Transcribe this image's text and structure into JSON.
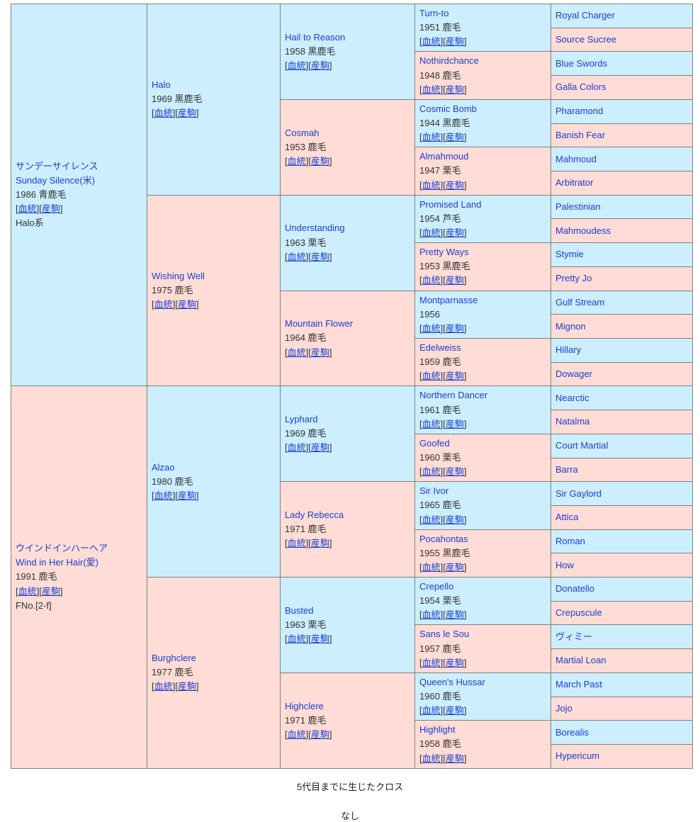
{
  "colors": {
    "sire_bg": "#cceeff",
    "dam_bg": "#ffdcd6",
    "border": "#808080",
    "link": "#1a3fd0",
    "text": "#333333"
  },
  "labels": {
    "pedigree_link": "血統",
    "offspring_link": "産駒",
    "bracket_open": "[",
    "bracket_close": "]"
  },
  "gen1": [
    {
      "name_ja": "サンデーサイレンス",
      "name_en": "Sunday Silence(米)",
      "meta": "1986 青鹿毛",
      "line": "Halo系",
      "type": "sire"
    },
    {
      "name_ja": "ウインドインハーヘア",
      "name_en": "Wind in Her Hair(愛)",
      "meta": "1991 鹿毛",
      "line": "FNo.[2-f]",
      "type": "dam"
    }
  ],
  "gen2": [
    {
      "name": "Halo",
      "meta": "1969 黒鹿毛",
      "type": "sire"
    },
    {
      "name": "Wishing Well",
      "meta": "1975 鹿毛",
      "type": "dam"
    },
    {
      "name": "Alzao",
      "meta": "1980 鹿毛",
      "type": "sire"
    },
    {
      "name": "Burghclere",
      "meta": "1977 鹿毛",
      "type": "dam"
    }
  ],
  "gen3": [
    {
      "name": "Hail to Reason",
      "meta": "1958 黒鹿毛",
      "type": "sire"
    },
    {
      "name": "Cosmah",
      "meta": "1953 鹿毛",
      "type": "dam"
    },
    {
      "name": "Understanding",
      "meta": "1963 栗毛",
      "type": "sire"
    },
    {
      "name": "Mountain Flower",
      "meta": "1964 鹿毛",
      "type": "dam"
    },
    {
      "name": "Lyphard",
      "meta": "1969 鹿毛",
      "type": "sire"
    },
    {
      "name": "Lady Rebecca",
      "meta": "1971 鹿毛",
      "type": "dam"
    },
    {
      "name": "Busted",
      "meta": "1963 栗毛",
      "type": "sire"
    },
    {
      "name": "Highclere",
      "meta": "1971 鹿毛",
      "type": "dam"
    }
  ],
  "gen4": [
    {
      "name": "Turn-to",
      "meta": "1951 鹿毛",
      "type": "sire"
    },
    {
      "name": "Nothirdchance",
      "meta": "1948 鹿毛",
      "type": "dam"
    },
    {
      "name": "Cosmic Bomb",
      "meta": "1944 黒鹿毛",
      "type": "sire"
    },
    {
      "name": "Almahmoud",
      "meta": "1947 栗毛",
      "type": "dam"
    },
    {
      "name": "Promised Land",
      "meta": "1954 芦毛",
      "type": "sire"
    },
    {
      "name": "Pretty Ways",
      "meta": "1953 黒鹿毛",
      "type": "dam"
    },
    {
      "name": "Montparnasse",
      "meta": "1956",
      "type": "sire"
    },
    {
      "name": "Edelweiss",
      "meta": "1959 鹿毛",
      "type": "dam"
    },
    {
      "name": "Northern Dancer",
      "meta": "1961 鹿毛",
      "type": "sire"
    },
    {
      "name": "Goofed",
      "meta": "1960 栗毛",
      "type": "dam"
    },
    {
      "name": "Sir Ivor",
      "meta": "1965 鹿毛",
      "type": "sire"
    },
    {
      "name": "Pocahontas",
      "meta": "1955 黒鹿毛",
      "type": "dam"
    },
    {
      "name": "Crepello",
      "meta": "1954 栗毛",
      "type": "sire"
    },
    {
      "name": "Sans le Sou",
      "meta": "1957 鹿毛",
      "type": "dam"
    },
    {
      "name": "Queen's Hussar",
      "meta": "1960 鹿毛",
      "type": "sire"
    },
    {
      "name": "Highlight",
      "meta": "1958 鹿毛",
      "type": "dam"
    }
  ],
  "gen5": [
    {
      "name": "Royal Charger",
      "type": "sire"
    },
    {
      "name": "Source Sucree",
      "type": "dam"
    },
    {
      "name": "Blue Swords",
      "type": "sire"
    },
    {
      "name": "Galla Colors",
      "type": "dam"
    },
    {
      "name": "Pharamond",
      "type": "sire"
    },
    {
      "name": "Banish Fear",
      "type": "dam"
    },
    {
      "name": "Mahmoud",
      "type": "sire"
    },
    {
      "name": "Arbitrator",
      "type": "dam"
    },
    {
      "name": "Palestinian",
      "type": "sire"
    },
    {
      "name": "Mahmoudess",
      "type": "dam"
    },
    {
      "name": "Stymie",
      "type": "sire"
    },
    {
      "name": "Pretty Jo",
      "type": "dam"
    },
    {
      "name": "Gulf Stream",
      "type": "sire"
    },
    {
      "name": "Mignon",
      "type": "dam"
    },
    {
      "name": "Hillary",
      "type": "sire"
    },
    {
      "name": "Dowager",
      "type": "dam"
    },
    {
      "name": "Nearctic",
      "type": "sire"
    },
    {
      "name": "Natalma",
      "type": "dam"
    },
    {
      "name": "Court Martial",
      "type": "sire"
    },
    {
      "name": "Barra",
      "type": "dam"
    },
    {
      "name": "Sir Gaylord",
      "type": "sire"
    },
    {
      "name": "Attica",
      "type": "dam"
    },
    {
      "name": "Roman",
      "type": "sire"
    },
    {
      "name": "How",
      "type": "dam"
    },
    {
      "name": "Donatello",
      "type": "sire"
    },
    {
      "name": "Crepuscule",
      "type": "dam"
    },
    {
      "name": "ヴィミー",
      "type": "sire"
    },
    {
      "name": "Martial Loan",
      "type": "dam"
    },
    {
      "name": "March Past",
      "type": "sire"
    },
    {
      "name": "Jojo",
      "type": "dam"
    },
    {
      "name": "Borealis",
      "type": "sire"
    },
    {
      "name": "Hypericum",
      "type": "dam"
    }
  ],
  "footer": {
    "cross_title": "5代目までに生じたクロス",
    "cross_value": "なし"
  }
}
